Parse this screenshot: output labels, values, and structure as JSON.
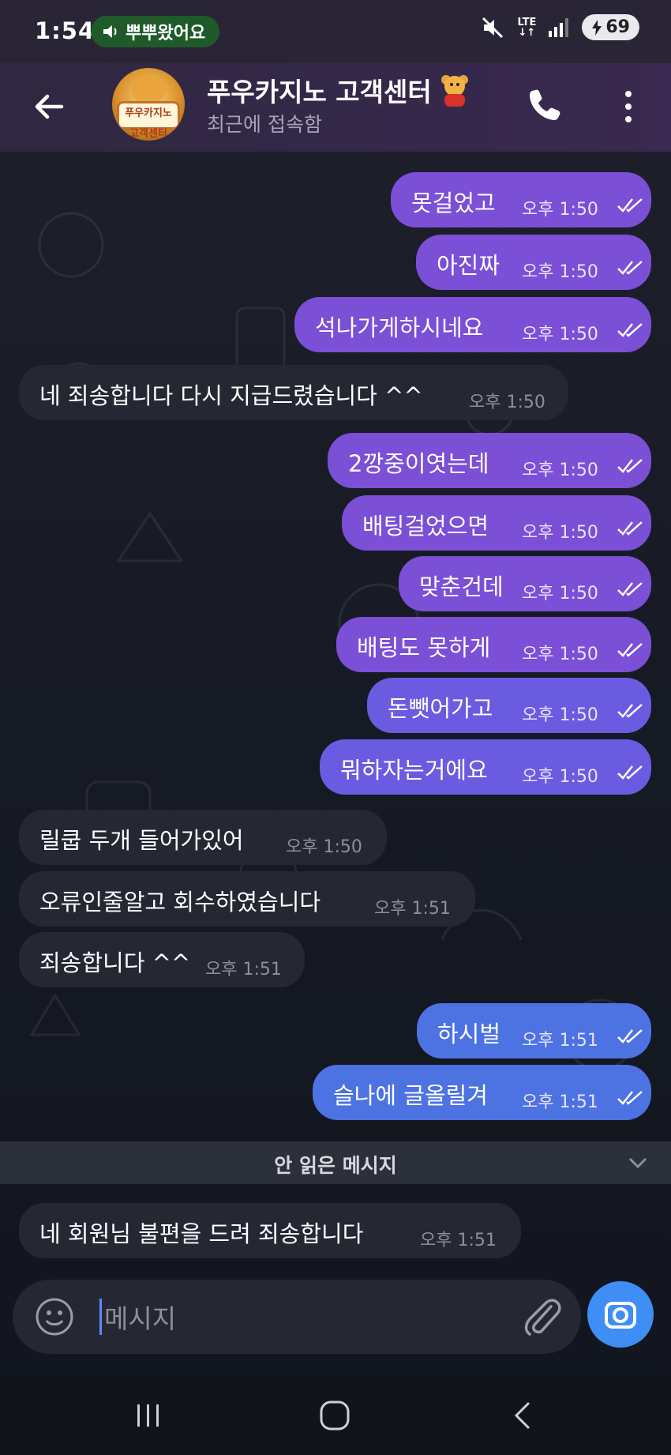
{
  "status_bar": {
    "time": "1:54",
    "call_label": "뿌뿌왔어요",
    "network": "LTE",
    "battery": "69"
  },
  "header": {
    "chat_title": "푸우카지노 고객센터",
    "status": "최근에 접속함",
    "avatar_text": "푸우카지노 고객센터"
  },
  "messages": [
    {
      "side": "out",
      "text": "못걸었고",
      "time": "오후 1:50"
    },
    {
      "side": "out",
      "text": "아진짜",
      "time": "오후 1:50"
    },
    {
      "side": "out",
      "text": "석나가게하시네요",
      "time": "오후 1:50"
    },
    {
      "side": "in",
      "text": "네 죄송합니다 다시 지급드렸습니다 ^^",
      "time": "오후 1:50"
    },
    {
      "side": "out",
      "text": "2깡중이엿는데",
      "time": "오후 1:50"
    },
    {
      "side": "out",
      "text": "배팅걸었으면",
      "time": "오후 1:50"
    },
    {
      "side": "out",
      "text": "맞춘건데",
      "time": "오후 1:50"
    },
    {
      "side": "out",
      "text": "배팅도 못하게",
      "time": "오후 1:50"
    },
    {
      "side": "out",
      "text": "돈뺏어가고",
      "time": "오후 1:50"
    },
    {
      "side": "out",
      "text": "뭐하자는거에요",
      "time": "오후 1:50"
    },
    {
      "side": "in",
      "text": "릴쿱 두개 들어가있어",
      "time": "오후 1:50"
    },
    {
      "side": "in",
      "text": "오류인줄알고 회수하였습니다",
      "time": "오후 1:51"
    },
    {
      "side": "in",
      "text": "죄송합니다 ^^",
      "time": "오후 1:51"
    },
    {
      "side": "out",
      "text": "하시벌",
      "time": "오후 1:51"
    },
    {
      "side": "out",
      "text": "슬나에 글올릴겨",
      "time": "오후 1:51"
    },
    {
      "side": "in",
      "text": "네 회원님 불편을 드려 죄송합니다",
      "time": "오후 1:51"
    }
  ],
  "unread_divider": "안 읽은 메시지",
  "input": {
    "placeholder": "메시지"
  },
  "colors": {
    "outgoing_purple": "#7b4fd6",
    "outgoing_blue": "#4d72e2",
    "incoming": "#252833",
    "accent": "#3f8ef5"
  }
}
